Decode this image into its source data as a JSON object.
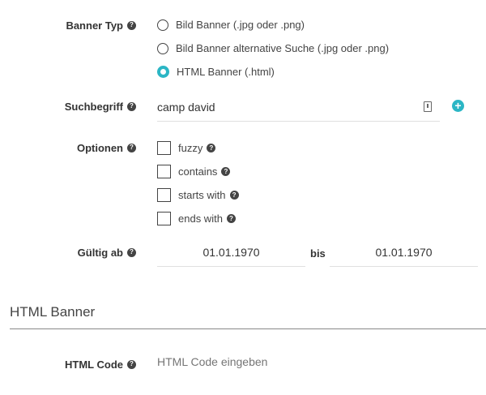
{
  "banner_typ": {
    "label": "Banner Typ",
    "options": [
      {
        "label": "Bild Banner (.jpg oder .png)",
        "selected": false
      },
      {
        "label": "Bild Banner alternative Suche (.jpg oder .png)",
        "selected": false
      },
      {
        "label": "HTML Banner (.html)",
        "selected": true
      }
    ]
  },
  "suchbegriff": {
    "label": "Suchbegriff",
    "value": "camp david"
  },
  "optionen": {
    "label": "Optionen",
    "items": [
      {
        "label": "fuzzy",
        "checked": false
      },
      {
        "label": "contains",
        "checked": false
      },
      {
        "label": "starts with",
        "checked": false
      },
      {
        "label": "ends with",
        "checked": false
      }
    ]
  },
  "gueltig": {
    "label": "Gültig ab",
    "from": "01.01.1970",
    "sep": "bis",
    "to": "01.01.1970"
  },
  "section": {
    "title": "HTML Banner"
  },
  "html_code": {
    "label": "HTML Code",
    "placeholder": "HTML Code eingeben"
  },
  "colors": {
    "accent": "#2bb6c5"
  },
  "icons": {
    "help": "question-circle-icon",
    "add": "plus-circle-icon",
    "contact": "contact-card-icon"
  }
}
